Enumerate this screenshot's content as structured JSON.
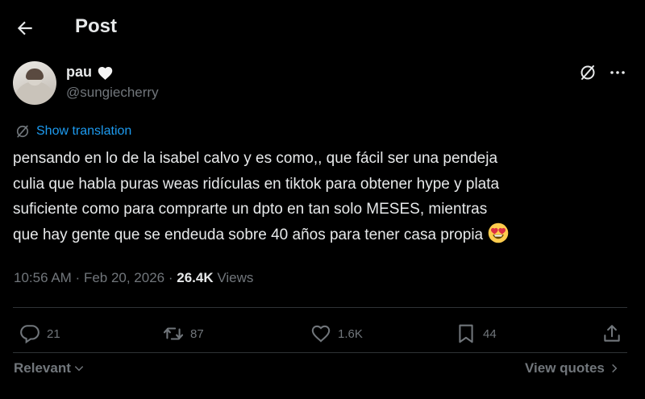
{
  "header": {
    "title": "Post",
    "back_icon": "arrow-left-icon"
  },
  "author": {
    "display_name": "pau",
    "name_emoji": "white-heart",
    "handle": "@sungiecherry"
  },
  "translation": {
    "label": "Show translation"
  },
  "tweet": {
    "lines": [
      "pensando en lo de la isabel calvo y es como,, que fácil ser una pendeja",
      "culia que habla puras weas ridículas en tiktok para obtener hype y plata",
      "suficiente como para comprarte un dpto en tan solo MESES, mientras",
      "que hay gente que se endeuda sobre 40 años para tener casa propia"
    ],
    "trailing_emoji": "heart-eyes"
  },
  "meta": {
    "time": "10:56 AM",
    "separator": " · ",
    "date": "Feb 20, 2026",
    "views_count": "26.4K",
    "views_label": " Views"
  },
  "actions": {
    "replies": "21",
    "reposts": "87",
    "likes": "1.6K",
    "bookmarks": "44"
  },
  "footer": {
    "sort_label": "Relevant",
    "view_quotes_label": "View quotes"
  },
  "colors": {
    "background": "#000000",
    "text": "#e7e9ea",
    "muted": "#71767b",
    "accent": "#1d9bf0",
    "divider": "#2f3336"
  }
}
